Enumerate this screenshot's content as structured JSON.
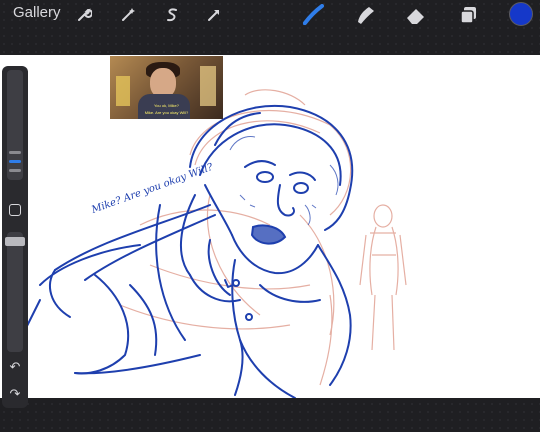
{
  "topbar": {
    "gallery_label": "Gallery",
    "tools": [
      "wrench-icon",
      "magic-wand-icon",
      "selection-icon",
      "transform-icon",
      "brush-icon",
      "smudge-icon",
      "eraser-icon",
      "layers-icon"
    ],
    "active_tool": "brush-icon",
    "current_color": "#1538c9"
  },
  "canvas": {
    "handwritten_note": "Mike? Are you okay Will?",
    "reference_subtitles": [
      "You ok, Mike?",
      "Mike. Are you okay Will?"
    ]
  },
  "colors": {
    "accent": "#2f7de9",
    "stroke_blue": "#1e3fae",
    "stroke_sketch": "#e3a79a"
  }
}
